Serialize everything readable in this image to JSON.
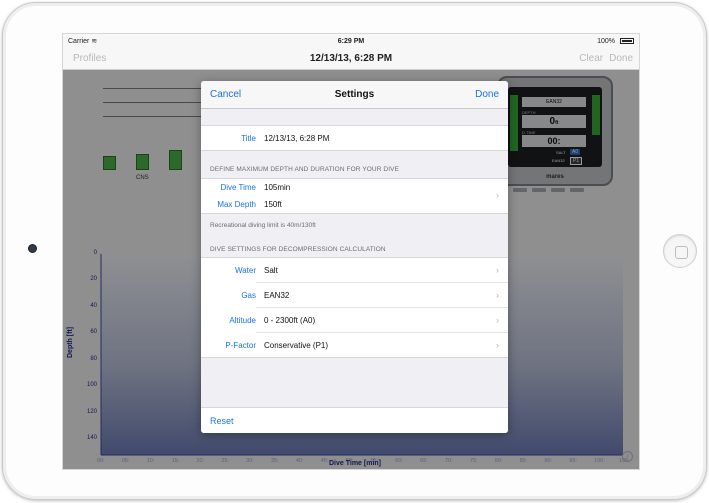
{
  "status_bar": {
    "carrier": "Carrier",
    "time": "6:29 PM",
    "battery": "100%"
  },
  "nav": {
    "left": "Profiles",
    "title": "12/13/13, 6:28 PM",
    "right": [
      "Clear",
      "Done"
    ]
  },
  "cns_label": "CNS",
  "chart": {
    "y_label": "Depth [ft]",
    "x_label": "Dive Time [min]",
    "y_ticks": [
      "0",
      "20",
      "40",
      "60",
      "80",
      "100",
      "120",
      "140"
    ],
    "x_ticks": [
      "00:",
      "05:",
      "10:",
      "15:",
      "20:",
      "25:",
      "30:",
      "35:",
      "40:",
      "45:",
      "50:",
      "55:",
      "60:",
      "65:",
      "70:",
      "75:",
      "80:",
      "85:",
      "90:",
      "95:",
      "100:",
      "105:"
    ]
  },
  "device": {
    "gas": "EAN32",
    "depth_label": "DEPTH",
    "depth": "0",
    "depth_unit": "ft",
    "dtime_label": "D.TIME",
    "dtime": "00:",
    "salt": "SALT",
    "a0": "A0",
    "p1": "P1",
    "ean": "EAN32",
    "brand": "mares"
  },
  "modal": {
    "cancel": "Cancel",
    "title": "Settings",
    "done": "Done",
    "title_row": {
      "label": "Title",
      "value": "12/13/13, 6:28 PM"
    },
    "section1_header": "DEFINE MAXIMUM DEPTH AND DURATION FOR YOUR DIVE",
    "dive_time": {
      "label": "Dive Time",
      "value": "105min"
    },
    "max_depth": {
      "label": "Max Depth",
      "value": "150ft"
    },
    "section1_footer": "Recreational diving limit is 40m/130ft",
    "section2_header": "DIVE SETTINGS FOR DECOMPRESSION CALCULATION",
    "water": {
      "label": "Water",
      "value": "Salt"
    },
    "gas": {
      "label": "Gas",
      "value": "EAN32"
    },
    "altitude": {
      "label": "Altitude",
      "value": "0 - 2300ft (A0)"
    },
    "pfactor": {
      "label": "P-Factor",
      "value": "Conservative (P1)"
    },
    "reset": "Reset"
  },
  "icons": {
    "chevron": "chevron-right-icon",
    "info": "info-icon",
    "wifi": "wifi-icon",
    "battery": "battery-icon"
  }
}
